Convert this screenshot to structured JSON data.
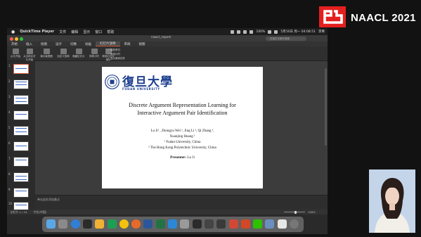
{
  "conference": {
    "name": "NAACL 2021",
    "brand_color": "#e4201e"
  },
  "menubar": {
    "app_name": "QuickTime Player",
    "items": [
      "文件",
      "编辑",
      "显示",
      "窗口",
      "帮助"
    ],
    "battery": "100%",
    "datetime": "5月10日 周一 04:08:51",
    "user": "李菁"
  },
  "window": {
    "title": "naacl_report",
    "search_placeholder": "在演示文稿中搜索"
  },
  "ribbon": {
    "tabs": [
      "开始",
      "插入",
      "绘图",
      "设计",
      "切换",
      "动画",
      "幻灯片放映",
      "审阅",
      "视图"
    ],
    "active_tab": "幻灯片放映",
    "buttons": [
      "从头开始",
      "从当前幻灯片开始",
      "演示者视图",
      "自定义放映",
      "隐藏幻灯片",
      "排练计时",
      "录制幻灯片演示",
      "设置幻灯片放映"
    ],
    "checkboxes": [
      "播放旁白",
      "使用计时",
      "显示媒体控件"
    ]
  },
  "thumbnails": {
    "numbers": [
      "1",
      "2",
      "3",
      "4",
      "5",
      "6",
      "7",
      "8",
      "9",
      "10"
    ],
    "active": "1"
  },
  "slide": {
    "university_cn": "復旦大學",
    "university_en": "FUDAN UNIVERSITY",
    "title_line1": "Discrete Argument Representation Learning for",
    "title_line2": "Interactive Argument Pair Identification",
    "authors_line1": "Lu Ji¹ , Zhongyu Wei ¹, Jing Li ², Qi Zhang ¹,",
    "authors_line2": "Xuanjing Huang ¹",
    "affiliation1": "¹ Fudan University, China",
    "affiliation2": "² The Hong Kong Polytechnic University, China",
    "presenter_label": "Presenter:",
    "presenter_name": "Lu Ji"
  },
  "notes": {
    "placeholder": "单击此处添加备注"
  },
  "statusbar": {
    "slide_count": "幻灯片 1 / 24",
    "language": "中文(中国)",
    "zoom_percent": "106%",
    "zoom_level": 0.55
  },
  "dock": {
    "icons": [
      "finder-icon",
      "launchpad-icon",
      "safari-icon",
      "terminal-icon",
      "photos-icon",
      "pycharm-icon",
      "chrome-icon",
      "firefox-icon",
      "word-icon",
      "excel-icon",
      "vscode-icon",
      "settings-icon",
      "terminal-icon",
      "cursor-icon",
      "quicktime-icon",
      "wps-icon",
      "powerpoint-icon",
      "wechat-icon",
      "preview-icon",
      "finder-window-icon",
      "trash-icon"
    ]
  }
}
